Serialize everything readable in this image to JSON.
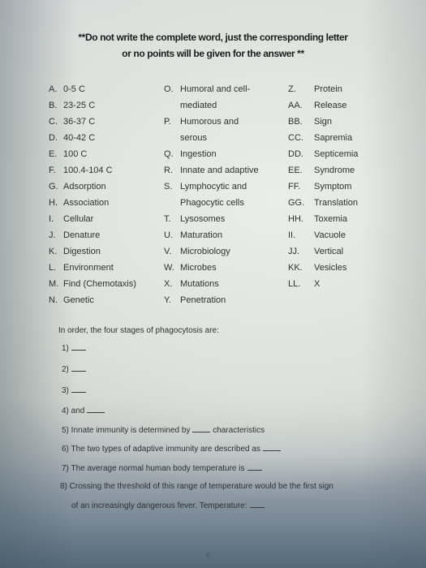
{
  "header": {
    "line1": "**Do not write the complete word, just the corresponding letter",
    "line2": "or no points will be given for the answer **"
  },
  "options": {
    "column1": [
      {
        "letter": "A.",
        "text": "0-5 C"
      },
      {
        "letter": "B.",
        "text": "23-25 C"
      },
      {
        "letter": "C.",
        "text": "36-37 C"
      },
      {
        "letter": "D.",
        "text": "40-42 C"
      },
      {
        "letter": "E.",
        "text": "100 C"
      },
      {
        "letter": "F.",
        "text": "100.4-104 C"
      },
      {
        "letter": "G.",
        "text": "Adsorption"
      },
      {
        "letter": "H.",
        "text": "Association"
      },
      {
        "letter": "I.",
        "text": "Cellular"
      },
      {
        "letter": "J.",
        "text": "Denature"
      },
      {
        "letter": "K.",
        "text": "Digestion"
      },
      {
        "letter": "L.",
        "text": "Environment"
      },
      {
        "letter": "M.",
        "text": "Find (Chemotaxis)"
      },
      {
        "letter": "N.",
        "text": "Genetic"
      }
    ],
    "column2": [
      {
        "letter": "O.",
        "text": "Humoral and cell-",
        "cont": "mediated"
      },
      {
        "letter": "P.",
        "text": "Humorous and",
        "cont": "serous"
      },
      {
        "letter": "Q.",
        "text": "Ingestion"
      },
      {
        "letter": "R.",
        "text": "Innate and adaptive"
      },
      {
        "letter": "S.",
        "text": "Lymphocytic and",
        "cont": "Phagocytic cells"
      },
      {
        "letter": "T.",
        "text": "Lysosomes"
      },
      {
        "letter": "U.",
        "text": "Maturation"
      },
      {
        "letter": "V.",
        "text": "Microbiology"
      },
      {
        "letter": "W.",
        "text": "Microbes"
      },
      {
        "letter": "X.",
        "text": "Mutations"
      },
      {
        "letter": "Y.",
        "text": "Penetration"
      }
    ],
    "column3": [
      {
        "letter": "Z.",
        "text": "Protein"
      },
      {
        "letter": "AA.",
        "text": "Release"
      },
      {
        "letter": "BB.",
        "text": "Sign"
      },
      {
        "letter": "CC.",
        "text": "Sapremia"
      },
      {
        "letter": "DD.",
        "text": "Septicemia"
      },
      {
        "letter": "EE.",
        "text": "Syndrome"
      },
      {
        "letter": "FF.",
        "text": "Symptom"
      },
      {
        "letter": "GG.",
        "text": "Translation"
      },
      {
        "letter": "HH.",
        "text": "Toxemia"
      },
      {
        "letter": "II.",
        "text": "Vacuole"
      },
      {
        "letter": "JJ.",
        "text": "Vertical"
      },
      {
        "letter": "KK.",
        "text": "Vesicles"
      },
      {
        "letter": "LL.",
        "text": "X"
      }
    ]
  },
  "questions": {
    "intro": "In order, the four stages of phagocytosis are:",
    "q1": "1)",
    "q2": "2)",
    "q3": "3)",
    "q4": "4) and",
    "q5a": "5) Innate immunity is determined by",
    "q5b": "characteristics",
    "q6": "6) The two types of adaptive immunity are described as",
    "q7": "7) The average normal human body temperature is",
    "q8a": "8) Crossing the threshold of this range of temperature would be the first sign",
    "q8b": "of an increasingly dangerous fever. Temperature:"
  },
  "page_number": "6"
}
